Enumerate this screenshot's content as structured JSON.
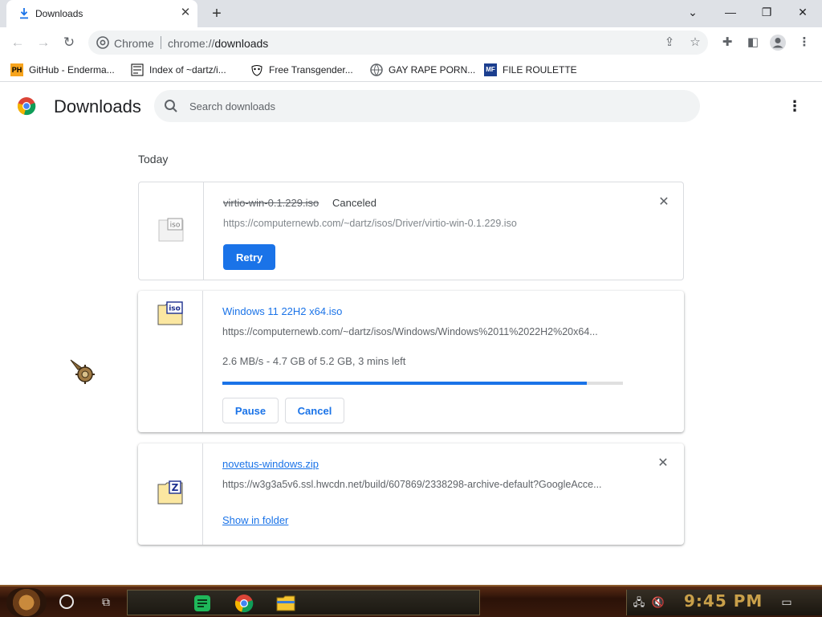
{
  "tab": {
    "title": "Downloads",
    "close": "✕",
    "new_tab": "+"
  },
  "window_controls": {
    "tab_search": "⌄",
    "minimize": "—",
    "restore": "❐",
    "close": "✕"
  },
  "omnibox": {
    "site_label": "Chrome",
    "url_scheme": "chrome://",
    "url_path": "downloads"
  },
  "bookmarks": [
    {
      "label": "GitHub - Enderma...",
      "icon": "PH"
    },
    {
      "label": "Index of ~dartz/i...",
      "icon": "folder-icon"
    },
    {
      "label": "Free Transgender...",
      "icon": "mask-icon"
    },
    {
      "label": "GAY RAPE PORN...",
      "icon": "globe-icon"
    },
    {
      "label": "FILE ROULETTE",
      "icon": "MF"
    }
  ],
  "header": {
    "title": "Downloads",
    "search_placeholder": "Search downloads",
    "menu": "⋮"
  },
  "section_label": "Today",
  "downloads": [
    {
      "filename": "virtio-win-0.1.229.iso",
      "status": "Canceled",
      "url": "https://computernewb.com/~dartz/isos/Driver/virtio-win-0.1.229.iso",
      "action": "Retry",
      "icon_badge": "iso",
      "close": "✕"
    },
    {
      "filename": "Windows 11 22H2 x64.iso",
      "url": "https://computernewb.com/~dartz/isos/Windows/Windows%2011%2022H2%20x64...",
      "progress_text": "2.6 MB/s - 4.7 GB of 5.2 GB, 3 mins left",
      "progress": 0.91,
      "pause_label": "Pause",
      "cancel_label": "Cancel",
      "icon_badge": "iso"
    },
    {
      "filename": "novetus-windows.zip",
      "url": "https://w3g3a5v6.ssl.hwcdn.net/build/607869/2338298-archive-default?GoogleAcce...",
      "action": "Show in folder",
      "icon_badge": "Z",
      "close": "✕"
    }
  ],
  "taskbar": {
    "clock": "9:45 PM"
  },
  "colors": {
    "accent": "#1a73e8",
    "tab_strip": "#dee1e6",
    "clock": "#c9a04a"
  }
}
